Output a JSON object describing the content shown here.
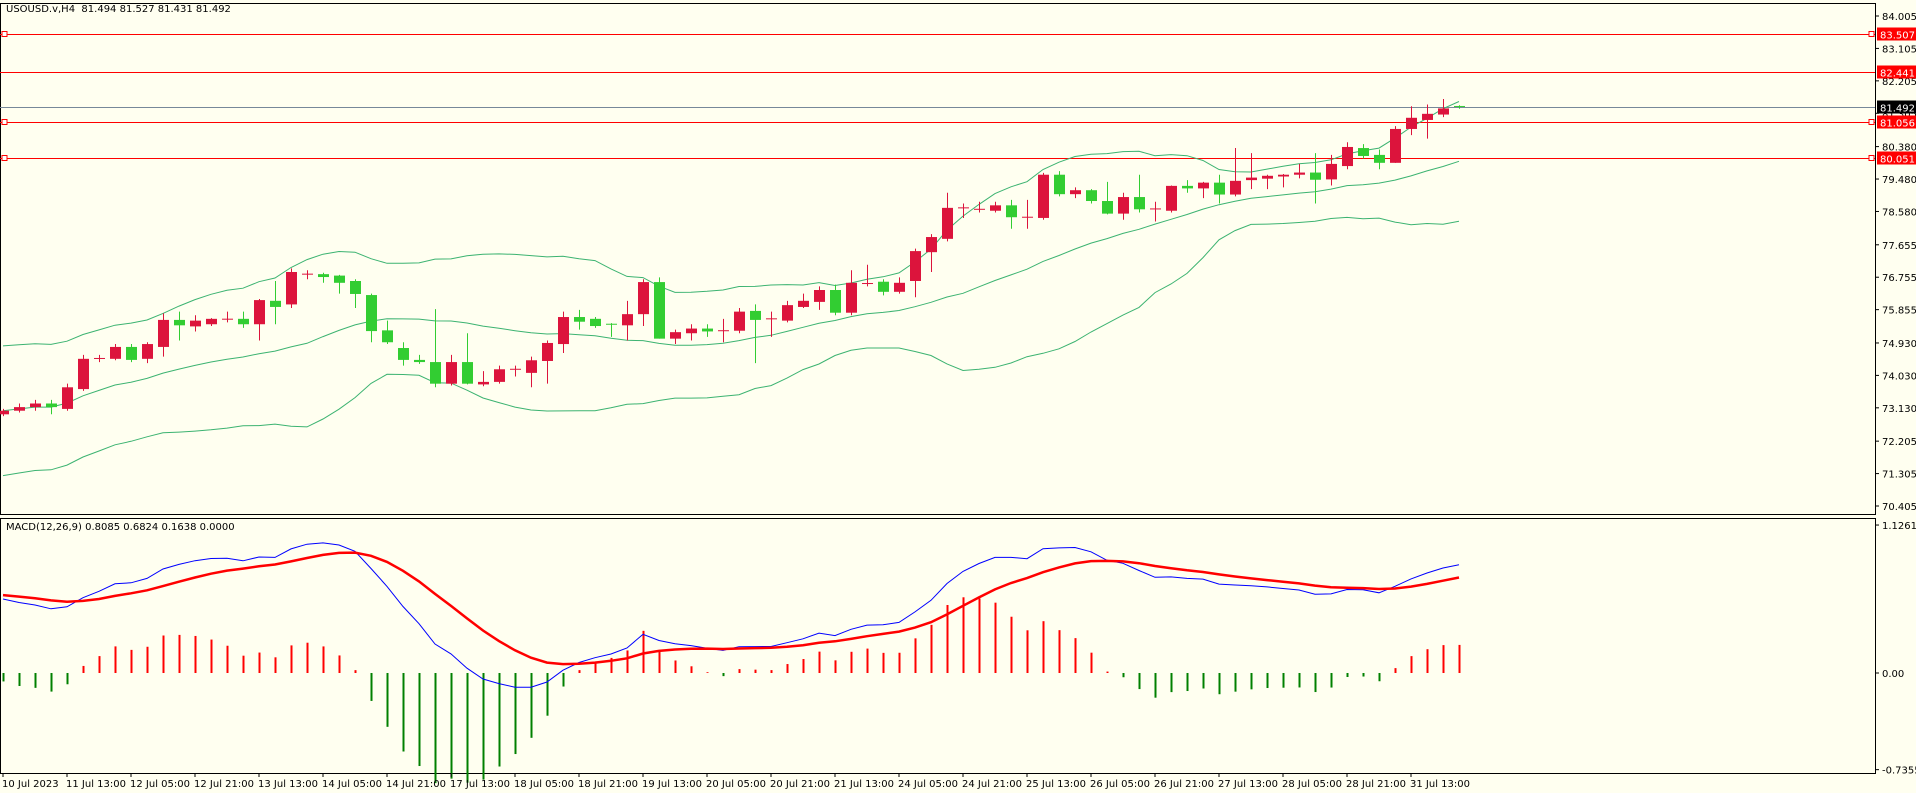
{
  "header": {
    "symbol": "USOUSD.v,H4",
    "ohlc": "81.494 81.527 81.431 81.492"
  },
  "macd_header": {
    "label": "MACD(12,26,9) 0.8085 0.6824 0.1638 0.0000"
  },
  "colors": {
    "background": "#fffff0",
    "bull": "#dc143c",
    "bear": "#32cd32",
    "bands": "#3cb371",
    "level_line": "#ff0000",
    "current_price_line": "#778899",
    "macd_line": "#0000ff",
    "signal_line": "#ff0000"
  },
  "chart_data": {
    "type": "candlestick",
    "title": "USOUSD.v,H4",
    "price_ticks": [
      "84.005",
      "83.105",
      "82.205",
      "81.305",
      "80.380",
      "79.480",
      "78.580",
      "77.655",
      "76.755",
      "75.855",
      "74.930",
      "74.030",
      "73.130",
      "72.205",
      "71.305",
      "70.405"
    ],
    "price_range": [
      70.405,
      84.005
    ],
    "levels": [
      {
        "price": 83.507,
        "label": "83.507",
        "handles": true
      },
      {
        "price": 82.441,
        "label": "82.441",
        "handles": false
      },
      {
        "price": 81.056,
        "label": "81.056",
        "handles": true
      },
      {
        "price": 80.051,
        "label": "80.051",
        "handles": true
      }
    ],
    "current_price": {
      "price": 81.492,
      "label": "81.492"
    },
    "macd_ticks": [
      {
        "v": 1.1261,
        "label": "1.1261"
      },
      {
        "v": 0,
        "label": "0.00"
      },
      {
        "v": -0.7355,
        "label": "-0.7355"
      }
    ],
    "time_labels": [
      "10 Jul 2023",
      "11 Jul 13:00",
      "12 Jul 05:00",
      "12 Jul 21:00",
      "13 Jul 13:00",
      "14 Jul 05:00",
      "14 Jul 21:00",
      "17 Jul 13:00",
      "18 Jul 05:00",
      "18 Jul 21:00",
      "19 Jul 13:00",
      "20 Jul 05:00",
      "20 Jul 21:00",
      "21 Jul 13:00",
      "24 Jul 05:00",
      "24 Jul 21:00",
      "25 Jul 13:00",
      "26 Jul 05:00",
      "26 Jul 21:00",
      "27 Jul 13:00",
      "28 Jul 05:00",
      "28 Jul 21:00",
      "31 Jul 13:00"
    ],
    "time_label_every_bars": 4,
    "ohlc": [
      [
        72.95,
        73.1,
        72.9,
        73.05
      ],
      [
        73.05,
        73.25,
        73.0,
        73.15
      ],
      [
        73.15,
        73.35,
        73.05,
        73.25
      ],
      [
        73.25,
        73.35,
        72.95,
        73.15
      ],
      [
        73.1,
        73.8,
        73.05,
        73.7
      ],
      [
        73.65,
        74.6,
        73.6,
        74.49
      ],
      [
        74.47,
        74.6,
        74.4,
        74.5
      ],
      [
        74.49,
        74.9,
        74.45,
        74.82
      ],
      [
        74.82,
        74.9,
        74.4,
        74.46
      ],
      [
        74.49,
        74.95,
        74.37,
        74.9
      ],
      [
        74.82,
        75.75,
        74.55,
        75.57
      ],
      [
        75.57,
        75.8,
        75.0,
        75.42
      ],
      [
        75.39,
        75.7,
        75.25,
        75.55
      ],
      [
        75.45,
        75.62,
        75.4,
        75.6
      ],
      [
        75.58,
        75.8,
        75.5,
        75.59
      ],
      [
        75.6,
        75.8,
        75.35,
        75.45
      ],
      [
        75.45,
        76.15,
        75.0,
        76.12
      ],
      [
        76.1,
        76.65,
        75.45,
        75.93
      ],
      [
        76.0,
        77.0,
        75.9,
        76.9
      ],
      [
        76.84,
        76.95,
        76.7,
        76.84
      ],
      [
        76.84,
        76.88,
        76.6,
        76.76
      ],
      [
        76.8,
        76.82,
        76.3,
        76.6
      ],
      [
        76.65,
        76.7,
        75.9,
        76.29
      ],
      [
        76.26,
        76.3,
        74.95,
        75.26
      ],
      [
        75.28,
        75.55,
        74.9,
        74.95
      ],
      [
        74.79,
        74.95,
        74.3,
        74.46
      ],
      [
        74.46,
        74.6,
        74.35,
        74.4
      ],
      [
        74.4,
        75.87,
        73.7,
        73.8
      ],
      [
        73.8,
        74.6,
        73.75,
        74.4
      ],
      [
        74.4,
        75.2,
        73.78,
        73.8
      ],
      [
        73.78,
        74.15,
        73.73,
        73.85
      ],
      [
        73.85,
        74.3,
        73.8,
        74.2
      ],
      [
        74.2,
        74.3,
        74.0,
        74.2
      ],
      [
        74.1,
        74.55,
        73.7,
        74.45
      ],
      [
        74.43,
        75.0,
        73.8,
        74.93
      ],
      [
        74.9,
        75.8,
        74.65,
        75.65
      ],
      [
        75.65,
        75.85,
        75.3,
        75.52
      ],
      [
        75.6,
        75.65,
        75.35,
        75.4
      ],
      [
        75.45,
        75.48,
        75.1,
        75.42
      ],
      [
        75.42,
        76.1,
        75.0,
        75.73
      ],
      [
        75.73,
        76.7,
        75.4,
        76.62
      ],
      [
        76.62,
        76.75,
        75.05,
        75.05
      ],
      [
        75.05,
        75.3,
        74.9,
        75.23
      ],
      [
        75.2,
        75.45,
        75.0,
        75.33
      ],
      [
        75.33,
        75.45,
        75.1,
        75.25
      ],
      [
        75.27,
        75.6,
        74.95,
        75.27
      ],
      [
        75.27,
        75.9,
        75.2,
        75.8
      ],
      [
        75.82,
        76.0,
        74.37,
        75.57
      ],
      [
        75.6,
        75.8,
        75.1,
        75.6
      ],
      [
        75.55,
        76.1,
        75.5,
        75.98
      ],
      [
        75.93,
        76.3,
        75.9,
        76.1
      ],
      [
        76.07,
        76.5,
        75.85,
        76.4
      ],
      [
        76.4,
        76.55,
        75.7,
        75.77
      ],
      [
        75.77,
        76.95,
        75.7,
        76.6
      ],
      [
        76.58,
        77.1,
        76.5,
        76.58
      ],
      [
        76.63,
        76.7,
        76.25,
        76.35
      ],
      [
        76.35,
        76.75,
        76.3,
        76.6
      ],
      [
        76.65,
        77.55,
        76.2,
        77.48
      ],
      [
        77.45,
        77.95,
        76.9,
        77.87
      ],
      [
        77.82,
        79.1,
        77.75,
        78.68
      ],
      [
        78.68,
        78.8,
        78.4,
        78.68
      ],
      [
        78.64,
        78.85,
        78.55,
        78.64
      ],
      [
        78.6,
        78.85,
        78.55,
        78.75
      ],
      [
        78.75,
        78.9,
        78.1,
        78.42
      ],
      [
        78.42,
        78.9,
        78.1,
        78.42
      ],
      [
        78.4,
        79.65,
        78.35,
        79.6
      ],
      [
        79.6,
        79.7,
        79.0,
        79.06
      ],
      [
        79.06,
        79.25,
        78.95,
        79.17
      ],
      [
        79.17,
        79.2,
        78.8,
        78.87
      ],
      [
        78.87,
        79.4,
        78.5,
        78.52
      ],
      [
        78.52,
        79.1,
        78.35,
        78.98
      ],
      [
        78.98,
        79.6,
        78.55,
        78.64
      ],
      [
        78.65,
        78.85,
        78.3,
        78.65
      ],
      [
        78.6,
        79.3,
        78.55,
        79.29
      ],
      [
        79.29,
        79.45,
        79.1,
        79.22
      ],
      [
        79.22,
        79.4,
        78.95,
        79.38
      ],
      [
        79.38,
        79.6,
        78.8,
        79.05
      ],
      [
        79.05,
        80.34,
        79.0,
        79.43
      ],
      [
        79.45,
        80.2,
        79.2,
        79.52
      ],
      [
        79.49,
        79.6,
        79.2,
        79.57
      ],
      [
        79.55,
        79.62,
        79.25,
        79.6
      ],
      [
        79.6,
        79.9,
        79.5,
        79.66
      ],
      [
        79.66,
        80.2,
        78.8,
        79.46
      ],
      [
        79.47,
        80.15,
        79.3,
        79.9
      ],
      [
        79.84,
        80.5,
        79.75,
        80.37
      ],
      [
        80.34,
        80.45,
        80.05,
        80.12
      ],
      [
        80.15,
        80.3,
        79.75,
        79.93
      ],
      [
        79.93,
        80.95,
        79.93,
        80.87
      ],
      [
        80.87,
        81.5,
        80.7,
        81.18
      ],
      [
        81.12,
        81.55,
        80.6,
        81.29
      ],
      [
        81.27,
        81.7,
        81.2,
        81.44
      ],
      [
        81.494,
        81.527,
        81.431,
        81.492
      ]
    ]
  }
}
